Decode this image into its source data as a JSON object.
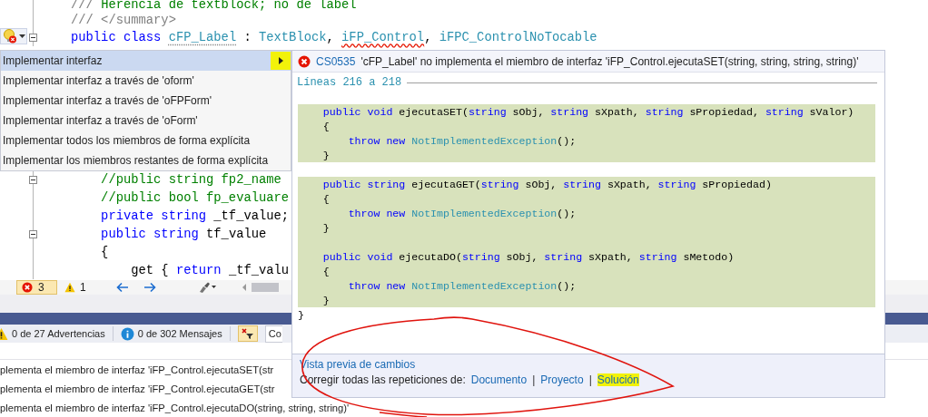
{
  "editor": {
    "lines_top": [
      {
        "fold": false,
        "tokens": [
          {
            "text": "/// ",
            "kind": "doc"
          },
          {
            "text": "Herencia de textblock; no de label",
            "kind": "comment"
          }
        ]
      },
      {
        "fold": false,
        "tokens": [
          {
            "text": "/// </summary>",
            "kind": "doc"
          }
        ]
      },
      {
        "fold": true,
        "tokens": [
          {
            "text": "public class ",
            "kind": "keyword"
          },
          {
            "text": "cFP_Label",
            "kind": "type_hint"
          },
          {
            "text": " : ",
            "kind": "plain"
          },
          {
            "text": "TextBlock",
            "kind": "type"
          },
          {
            "text": ", ",
            "kind": "plain"
          },
          {
            "text": "iFP_Control",
            "kind": "type_error"
          },
          {
            "text": ", ",
            "kind": "plain"
          },
          {
            "text": "iFPC_ControlNoTocable",
            "kind": "type"
          }
        ]
      }
    ],
    "lines_bottom": [
      {
        "fold": true,
        "tokens": [
          {
            "text": "    //public string fp2_name",
            "kind": "comment"
          }
        ]
      },
      {
        "fold": false,
        "tokens": [
          {
            "text": "    //public bool fp_evaluare",
            "kind": "comment"
          }
        ]
      },
      {
        "fold": false,
        "tokens": [
          {
            "text": "    private string",
            "kind": "keyword"
          },
          {
            "text": " _tf_value;",
            "kind": "plain"
          }
        ]
      },
      {
        "fold": true,
        "tokens": [
          {
            "text": "    public string",
            "kind": "keyword"
          },
          {
            "text": " tf_value",
            "kind": "plain"
          }
        ]
      },
      {
        "fold": false,
        "tokens": [
          {
            "text": "    {",
            "kind": "plain"
          }
        ]
      },
      {
        "fold": false,
        "tokens": [
          {
            "text": "        get { ",
            "kind": "plain"
          },
          {
            "text": "return",
            "kind": "keyword"
          },
          {
            "text": " _tf_valu",
            "kind": "plain"
          }
        ]
      }
    ]
  },
  "status_strip": {
    "errors": "3",
    "warnings": "1"
  },
  "error_list": {
    "warnings": "0 de 27 Advertencias",
    "messages": "0 de 302 Mensajes",
    "scope": "Co",
    "rows": [
      {
        "description": "plementa el miembro de interfaz 'iFP_Control.ejecutaSET(str"
      },
      {
        "description": "plementa el miembro de interfaz 'iFP_Control.ejecutaGET(str"
      },
      {
        "description": "plementa el miembro de interfaz 'iFP_Control.ejecutaDO(string, string, string)'"
      }
    ]
  },
  "quick_actions": {
    "items": [
      {
        "label": "Implementar interfaz",
        "selected": true,
        "submenu": true
      },
      {
        "label": "Implementar interfaz a través de 'oform'",
        "selected": false,
        "submenu": false
      },
      {
        "label": "Implementar interfaz a través de 'oFPForm'",
        "selected": false,
        "submenu": false
      },
      {
        "label": "Implementar interfaz a través de 'oForm'",
        "selected": false,
        "submenu": false
      },
      {
        "label": "Implementar todos los miembros de forma explícita",
        "selected": false,
        "submenu": false
      },
      {
        "label": "Implementar los miembros restantes de forma explícita",
        "selected": false,
        "submenu": false
      }
    ]
  },
  "preview": {
    "code": "CS0535",
    "message": "'cFP_Label' no implementa el miembro de interfaz 'iFP_Control.ejecutaSET(string, string, string, string)'",
    "range": "Líneas 216 a 218",
    "lines": [
      {
        "added": true,
        "tokens": [
          {
            "text": "    public void",
            "kind": "keyword"
          },
          {
            "text": " ejecutaSET(",
            "kind": "plain"
          },
          {
            "text": "string",
            "kind": "keyword"
          },
          {
            "text": " sObj, ",
            "kind": "plain"
          },
          {
            "text": "string",
            "kind": "keyword"
          },
          {
            "text": " sXpath, ",
            "kind": "plain"
          },
          {
            "text": "string",
            "kind": "keyword"
          },
          {
            "text": " sPropiedad, ",
            "kind": "plain"
          },
          {
            "text": "string",
            "kind": "keyword"
          },
          {
            "text": " sValor)",
            "kind": "plain"
          }
        ]
      },
      {
        "added": true,
        "tokens": [
          {
            "text": "    {",
            "kind": "plain"
          }
        ]
      },
      {
        "added": true,
        "tokens": [
          {
            "text": "        throw new ",
            "kind": "keyword"
          },
          {
            "text": "NotImplementedException",
            "kind": "type"
          },
          {
            "text": "();",
            "kind": "plain"
          }
        ]
      },
      {
        "added": true,
        "tokens": [
          {
            "text": "    }",
            "kind": "plain"
          }
        ]
      },
      {
        "added": false
      },
      {
        "added": true,
        "tokens": [
          {
            "text": "    public string",
            "kind": "keyword"
          },
          {
            "text": " ejecutaGET(",
            "kind": "plain"
          },
          {
            "text": "string",
            "kind": "keyword"
          },
          {
            "text": " sObj, ",
            "kind": "plain"
          },
          {
            "text": "string",
            "kind": "keyword"
          },
          {
            "text": " sXpath, ",
            "kind": "plain"
          },
          {
            "text": "string",
            "kind": "keyword"
          },
          {
            "text": " sPropiedad)",
            "kind": "plain"
          }
        ]
      },
      {
        "added": true,
        "tokens": [
          {
            "text": "    {",
            "kind": "plain"
          }
        ]
      },
      {
        "added": true,
        "tokens": [
          {
            "text": "        throw new ",
            "kind": "keyword"
          },
          {
            "text": "NotImplementedException",
            "kind": "type"
          },
          {
            "text": "();",
            "kind": "plain"
          }
        ]
      },
      {
        "added": true,
        "tokens": [
          {
            "text": "    }",
            "kind": "plain"
          }
        ]
      },
      {
        "added": true
      },
      {
        "added": true,
        "tokens": [
          {
            "text": "    public void",
            "kind": "keyword"
          },
          {
            "text": " ejecutaDO(",
            "kind": "plain"
          },
          {
            "text": "string",
            "kind": "keyword"
          },
          {
            "text": " sObj, ",
            "kind": "plain"
          },
          {
            "text": "string",
            "kind": "keyword"
          },
          {
            "text": " sXpath, ",
            "kind": "plain"
          },
          {
            "text": "string",
            "kind": "keyword"
          },
          {
            "text": " sMetodo)",
            "kind": "plain"
          }
        ]
      },
      {
        "added": true,
        "tokens": [
          {
            "text": "    {",
            "kind": "plain"
          }
        ]
      },
      {
        "added": true,
        "tokens": [
          {
            "text": "        throw new ",
            "kind": "keyword"
          },
          {
            "text": "NotImplementedException",
            "kind": "type"
          },
          {
            "text": "();",
            "kind": "plain"
          }
        ]
      },
      {
        "added": true,
        "tokens": [
          {
            "text": "    }",
            "kind": "plain"
          }
        ]
      },
      {
        "added": false,
        "tokens": [
          {
            "text": "}",
            "kind": "plain"
          }
        ]
      }
    ],
    "preview_link": "Vista previa de cambios",
    "fix_all_label": "Corregir todas las repeticiones de:",
    "fix_scopes": [
      {
        "label": "Documento",
        "highlighted": false
      },
      {
        "prefix": "|",
        "label": "Proyecto",
        "highlighted": false
      },
      {
        "prefix": "|",
        "label": "Solución",
        "highlighted": true
      }
    ]
  }
}
